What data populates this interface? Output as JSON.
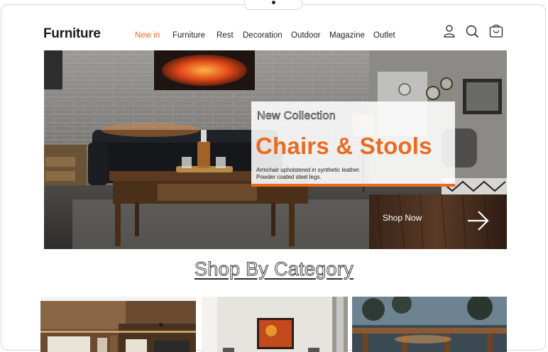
{
  "header": {
    "logo": "Furniture",
    "nav": [
      {
        "label": "New in",
        "active": true
      },
      {
        "label": "Furniture",
        "active": false
      },
      {
        "label": "Rest",
        "active": false
      },
      {
        "label": "Decoration",
        "active": false
      },
      {
        "label": "Outdoor",
        "active": false
      },
      {
        "label": "Magazine",
        "active": false
      },
      {
        "label": "Outlet",
        "active": false
      }
    ],
    "icons": [
      "user-icon",
      "search-icon",
      "cart-icon"
    ]
  },
  "hero": {
    "subtitle": "New Collection",
    "title": "Chairs & Stools",
    "description_line1": "Armchair upholstered in synthetic leather.",
    "description_line2": "Powder coated steel legs.",
    "cta_label": "Shop Now"
  },
  "categories": {
    "heading": "Shop By Category"
  },
  "colors": {
    "accent": "#ea6a1f",
    "text": "#1c1c1c"
  }
}
